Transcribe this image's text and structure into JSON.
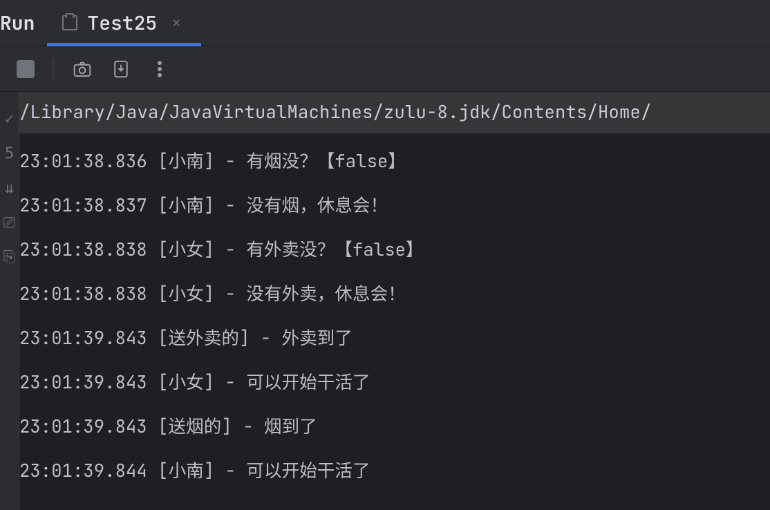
{
  "tabs": {
    "run_label": "Run",
    "active_tab": "Test25"
  },
  "command_line": "/Library/Java/JavaVirtualMachines/zulu-8.jdk/Contents/Home/",
  "log": [
    "23:01:38.836 [小南] - 有烟没？【false】",
    "23:01:38.837 [小南] - 没有烟，休息会！",
    "23:01:38.838 [小女] - 有外卖没？【false】",
    "23:01:38.838 [小女] - 没有外卖，休息会！",
    "23:01:39.843 [送外卖的] - 外卖到了",
    "23:01:39.843 [小女] - 可以开始干活了",
    "23:01:39.843 [送烟的] - 烟到了",
    "23:01:39.844 [小南] - 可以开始干活了"
  ],
  "gutter_glyphs": [
    "✓",
    "5",
    "⇊",
    "⎚",
    "⎘"
  ]
}
